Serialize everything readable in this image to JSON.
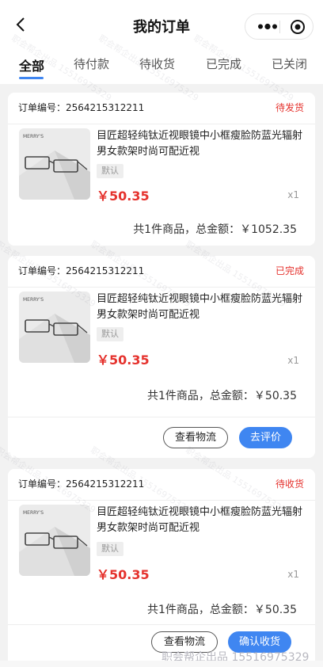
{
  "nav": {
    "title": "我的订单",
    "back_icon": "chevron-left-icon",
    "more_icon": "more-dots-icon",
    "close_icon": "target-circle-icon"
  },
  "tabs": [
    {
      "label": "全部",
      "active": true
    },
    {
      "label": "待付款",
      "active": false
    },
    {
      "label": "待收货",
      "active": false
    },
    {
      "label": "已完成",
      "active": false
    },
    {
      "label": "已关闭",
      "active": false
    }
  ],
  "colors": {
    "accent": "#3f86f1",
    "price": "#e5322d",
    "background": "#f2f2f2"
  },
  "orders": [
    {
      "order_no": "订单编号：2564215312211",
      "status": "待发货",
      "brand": "MERRY'S",
      "product_name": "目匠超轻纯钛近视眼镜中小框瘦脸防蓝光辐射男女款架时尚可配近视",
      "spec": "默认",
      "price": "￥50.35",
      "qty": "x1",
      "total": "共1件商品，总金额：￥1052.35",
      "buttons": []
    },
    {
      "order_no": "订单编号：2564215312211",
      "status": "已完成",
      "brand": "MERRY'S",
      "product_name": "目匠超轻纯钛近视眼镜中小框瘦脸防蓝光辐射男女款架时尚可配近视",
      "spec": "默认",
      "price": "￥50.35",
      "qty": "x1",
      "total": "共1件商品，总金额：￥50.35",
      "buttons": [
        {
          "label": "查看物流"
        },
        {
          "label": "去评价"
        }
      ]
    },
    {
      "order_no": "订单编号：2564215312211",
      "status": "待收货",
      "brand": "MERRY'S",
      "product_name": "目匠超轻纯钛近视眼镜中小框瘦脸防蓝光辐射男女款架时尚可配近视",
      "spec": "默认",
      "price": "￥50.35",
      "qty": "x1",
      "total": "共1件商品，总金额：￥50.35",
      "buttons": [
        {
          "label": "查看物流"
        },
        {
          "label": "确认收货"
        }
      ]
    }
  ],
  "watermark": {
    "repeat_text": "职会帮企出品 15516975329",
    "footer": "职会帮企出品 15516975329"
  }
}
